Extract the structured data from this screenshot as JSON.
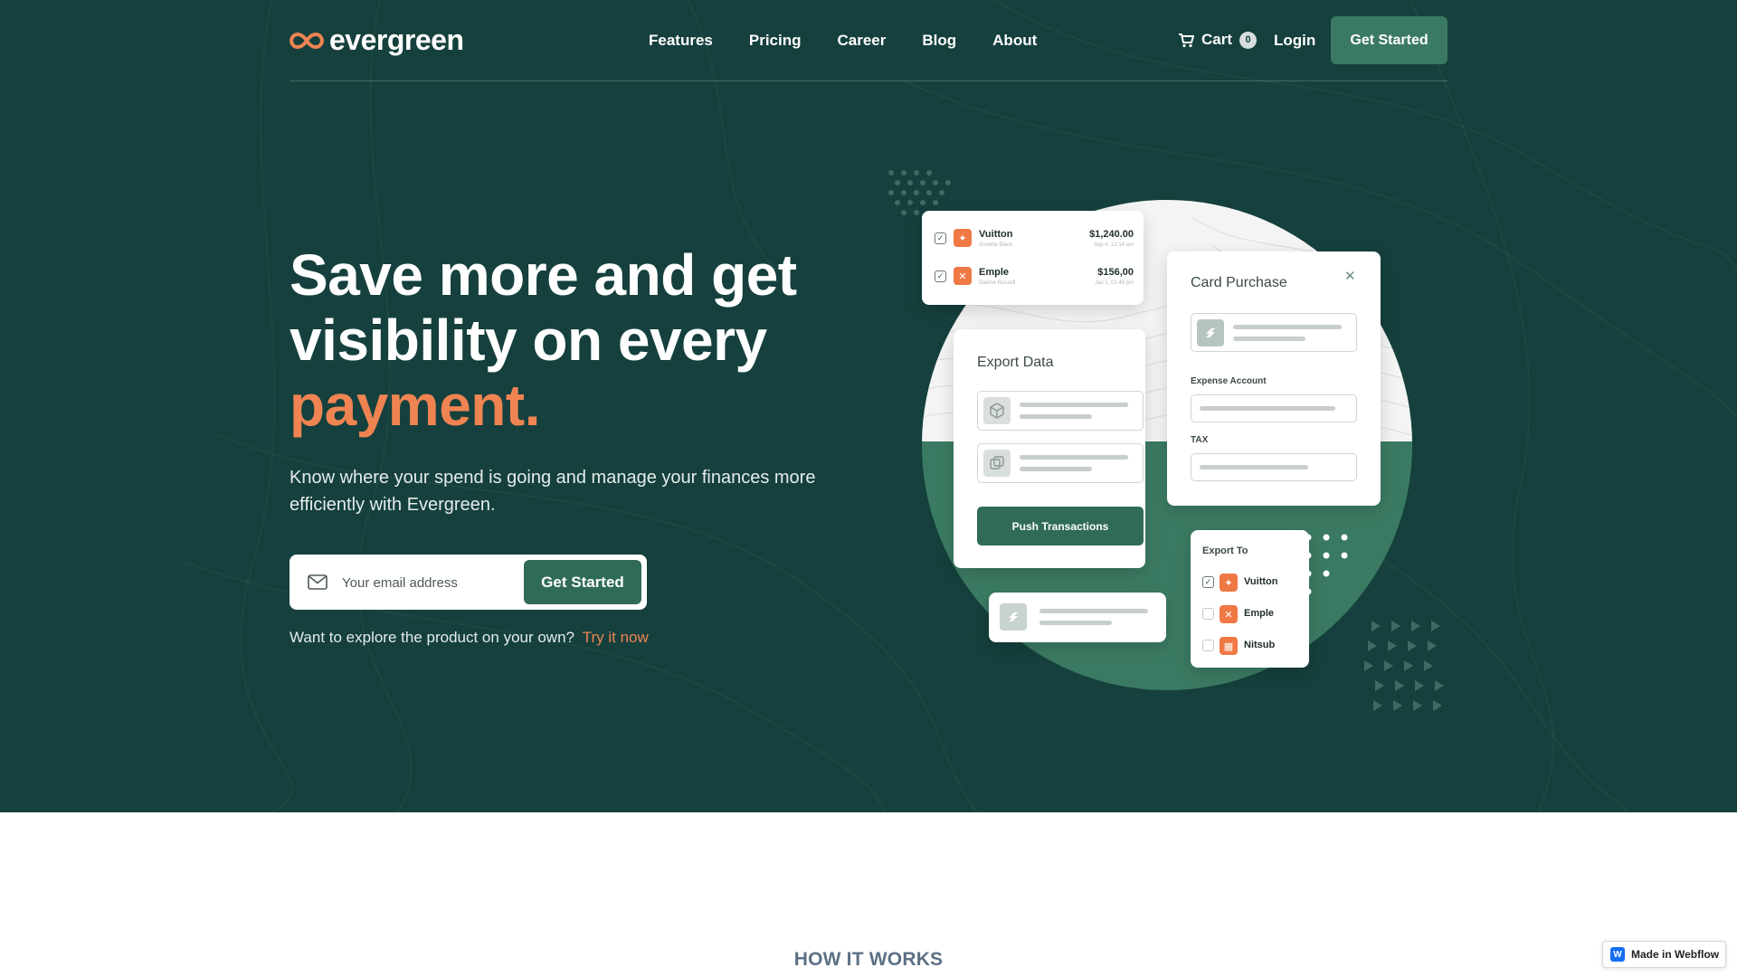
{
  "nav": {
    "logo": "evergreen",
    "links": [
      "Features",
      "Pricing",
      "Career",
      "Blog",
      "About"
    ],
    "cart_label": "Cart",
    "cart_count": "0",
    "login": "Login",
    "cta": "Get Started"
  },
  "hero": {
    "headline_line1": "Save more and get",
    "headline_line2": "visibility on every",
    "headline_accent": "payment.",
    "subline": "Know where your spend is going and manage your finances more efficiently with Evergreen.",
    "email_placeholder": "Your email address",
    "signup_button": "Get Started",
    "explore_text": "Want to explore the product on your own?",
    "explore_link": "Try it now"
  },
  "illustration": {
    "transactions": [
      {
        "name": "Vuitton",
        "person": "Annette Black",
        "amount": "$1,240.00",
        "date": "Sep 4, 12:14 am"
      },
      {
        "name": "Emple",
        "person": "Dianne Russell",
        "amount": "$156,00",
        "date": "Jan 1, 01:49 pm"
      }
    ],
    "export_title": "Export Data",
    "push_button": "Push Transactions",
    "purchase_title": "Card Purchase",
    "expense_label": "Expense Account",
    "tax_label": "TAX",
    "export_to_title": "Export To",
    "export_to": [
      "Vuitton",
      "Emple",
      "Nitsub"
    ]
  },
  "section": {
    "how_it_works": "HOW IT WORKS"
  },
  "badge": {
    "label": "Made in Webflow"
  },
  "colors": {
    "hero_bg": "#15403d",
    "accent_orange": "#ef8452",
    "primary_green": "#3b7a62"
  }
}
